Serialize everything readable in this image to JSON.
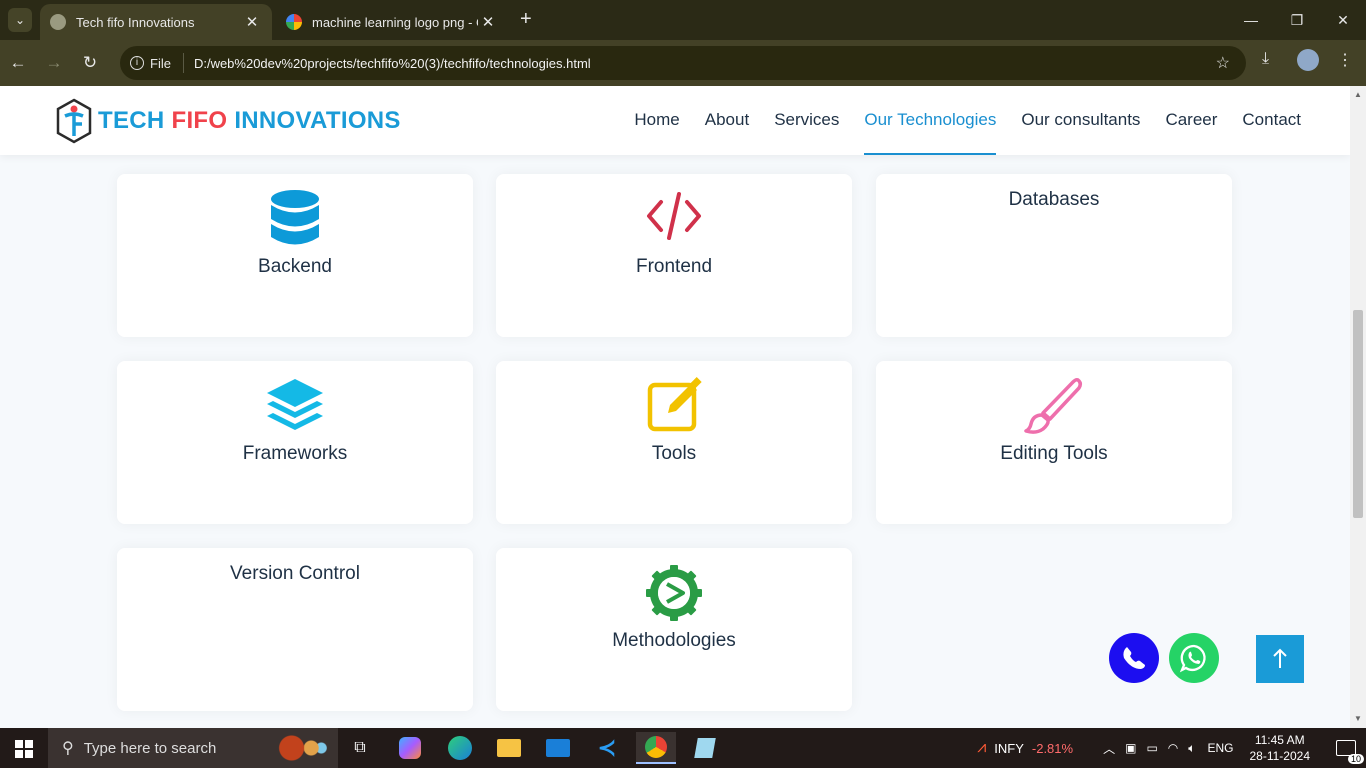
{
  "browser": {
    "tabs": [
      {
        "title": "Tech fifo Innovations",
        "active": true
      },
      {
        "title": "machine learning logo png - Go",
        "active": false
      }
    ],
    "chip_label": "File",
    "url": "D:/web%20dev%20projects/techfifo%20(3)/techfifo/technologies.html"
  },
  "brand": {
    "part1": "TECH ",
    "part2": "FIFO ",
    "part3": "INNOVATIONS",
    "color1": "#1a9bd7",
    "color2": "#f0424b"
  },
  "nav": [
    {
      "label": "Home"
    },
    {
      "label": "About"
    },
    {
      "label": "Services"
    },
    {
      "label": "Our Technologies",
      "active": true
    },
    {
      "label": "Our consultants"
    },
    {
      "label": "Career"
    },
    {
      "label": "Contact"
    }
  ],
  "cards": [
    {
      "label": "Backend",
      "icon": "database-icon",
      "color": "#0d9ad8"
    },
    {
      "label": "Frontend",
      "icon": "code-icon",
      "color": "#d0314a"
    },
    {
      "label": "Databases",
      "icon": "none"
    },
    {
      "label": "Frameworks",
      "icon": "layers-icon",
      "color": "#14b9e6"
    },
    {
      "label": "Tools",
      "icon": "edit-icon",
      "color": "#f2c200"
    },
    {
      "label": "Editing Tools",
      "icon": "brush-icon",
      "color": "#ee6fac"
    },
    {
      "label": "Version Control",
      "icon": "none"
    },
    {
      "label": "Methodologies",
      "icon": "gear-icon",
      "color": "#2a9c45"
    }
  ],
  "fabs": {
    "phone_color": "#1c0ef0",
    "whatsapp_color": "#25d366",
    "top_color": "#1a9bd7"
  },
  "taskbar": {
    "search_placeholder": "Type here to search",
    "stock_name": "INFY",
    "stock_change": "-2.81%",
    "lang": "ENG",
    "time": "11:45 AM",
    "date": "28-11-2024",
    "notifications": "10"
  }
}
